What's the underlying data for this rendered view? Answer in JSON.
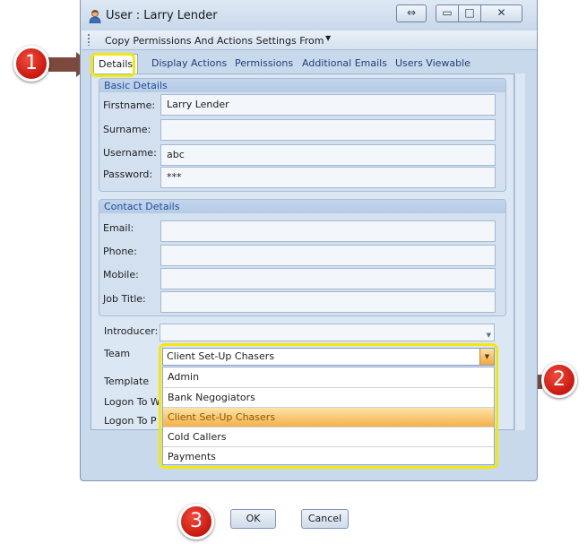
{
  "window": {
    "title": "User : Larry Lender",
    "restore_glyph": "⇔",
    "min_glyph": "▭",
    "max_glyph": "□",
    "close_glyph": "✕"
  },
  "toolbar": {
    "copy_label": "Copy Permissions And Actions Settings From",
    "copy_arrow": "▼"
  },
  "tabs": [
    "Details",
    "Display Actions",
    "Permissions",
    "Additional Emails",
    "Users Viewable"
  ],
  "basic_details": {
    "title": "Basic Details",
    "firstname_label": "Firstname:",
    "firstname_value": "Larry Lender",
    "surname_label": "Surname:",
    "surname_value": "",
    "username_label": "Username:",
    "username_value": "abc",
    "password_label": "Password:",
    "password_value": "***"
  },
  "contact_details": {
    "title": "Contact Details",
    "email_label": "Email:",
    "phone_label": "Phone:",
    "mobile_label": "Mobile:",
    "jobtitle_label": "Job Title:"
  },
  "extra": {
    "introducer_label": "Introducer:",
    "team_label": "Team",
    "template_label": "Template",
    "logon_to_w_label": "Logon To W",
    "logon_to_p_label": "Logon To P"
  },
  "team_dropdown": {
    "selected": "Client Set-Up Chasers",
    "arrow": "▼",
    "options": [
      "Admin",
      "Bank Negogiators",
      "Client Set-Up Chasers",
      "Cold Callers",
      "Payments"
    ],
    "selected_index": 2
  },
  "buttons": {
    "ok": "OK",
    "cancel": "Cancel"
  },
  "annotations": {
    "badge1": "1",
    "badge2": "2",
    "badge3": "3"
  },
  "colors": {
    "annotation_red": "#d0201a",
    "highlight_yellow": "#f3e70b",
    "arrow_brown": "#7b4a3d"
  }
}
